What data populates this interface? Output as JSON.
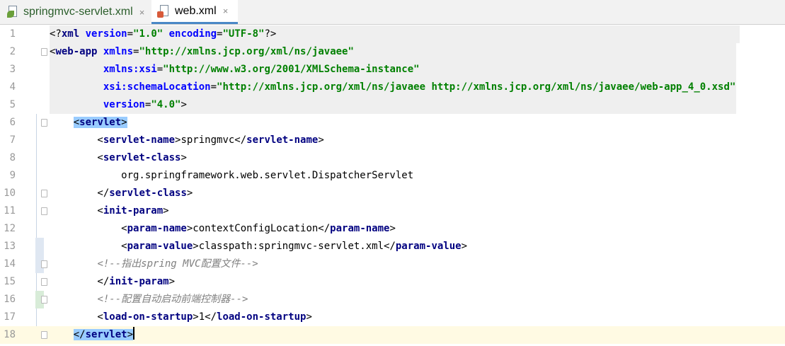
{
  "tabs": [
    {
      "label": "springmvc-servlet.xml",
      "close": "×",
      "icon": "spring-xml-file-icon",
      "active": false
    },
    {
      "label": "web.xml",
      "close": "×",
      "icon": "xml-file-icon",
      "active": true
    }
  ],
  "editor": {
    "caret_line": 18,
    "lines": [
      {
        "n": "1",
        "parts": [
          [
            "txt",
            "<?"
          ],
          [
            "tag",
            "xml"
          ],
          [
            "attr",
            " version"
          ],
          [
            "txt",
            "="
          ],
          [
            "str",
            "\"1.0\""
          ],
          [
            "attr",
            " encoding"
          ],
          [
            "txt",
            "="
          ],
          [
            "str",
            "\"UTF-8\""
          ],
          [
            "txt",
            "?>"
          ]
        ]
      },
      {
        "n": "2",
        "parts": [
          [
            "txt",
            "<"
          ],
          [
            "tag",
            "web-app"
          ],
          [
            "attr",
            " xmlns"
          ],
          [
            "txt",
            "="
          ],
          [
            "str",
            "\"http://xmlns.jcp.org/xml/ns/javaee\""
          ]
        ]
      },
      {
        "n": "3",
        "parts": [
          [
            "txt",
            "         "
          ],
          [
            "attr",
            "xmlns:xsi"
          ],
          [
            "txt",
            "="
          ],
          [
            "str",
            "\"http://www.w3.org/2001/XMLSchema-instance\""
          ]
        ]
      },
      {
        "n": "4",
        "parts": [
          [
            "txt",
            "         "
          ],
          [
            "attr",
            "xsi:schemaLocation"
          ],
          [
            "txt",
            "="
          ],
          [
            "str",
            "\"http://xmlns.jcp.org/xml/ns/javaee http://xmlns.jcp.org/xml/ns/javaee/web-app_4_0.xsd\""
          ]
        ]
      },
      {
        "n": "5",
        "parts": [
          [
            "txt",
            "         "
          ],
          [
            "attr",
            "version"
          ],
          [
            "txt",
            "="
          ],
          [
            "str",
            "\"4.0\""
          ],
          [
            "txt",
            ">"
          ]
        ]
      },
      {
        "n": "6",
        "parts": [
          [
            "txt",
            "    "
          ],
          [
            "match",
            "<servlet>"
          ]
        ]
      },
      {
        "n": "7",
        "parts": [
          [
            "txt",
            "        <"
          ],
          [
            "tag",
            "servlet-name"
          ],
          [
            "txt",
            ">springmvc</"
          ],
          [
            "tag",
            "servlet-name"
          ],
          [
            "txt",
            ">"
          ]
        ]
      },
      {
        "n": "8",
        "parts": [
          [
            "txt",
            "        <"
          ],
          [
            "tag",
            "servlet-class"
          ],
          [
            "txt",
            ">"
          ]
        ]
      },
      {
        "n": "9",
        "parts": [
          [
            "txt",
            "            org.springframework.web.servlet.DispatcherServlet"
          ]
        ]
      },
      {
        "n": "10",
        "parts": [
          [
            "txt",
            "        </"
          ],
          [
            "tag",
            "servlet-class"
          ],
          [
            "txt",
            ">"
          ]
        ]
      },
      {
        "n": "11",
        "parts": [
          [
            "txt",
            "        <"
          ],
          [
            "tag",
            "init-param"
          ],
          [
            "txt",
            ">"
          ]
        ]
      },
      {
        "n": "12",
        "parts": [
          [
            "txt",
            "            <"
          ],
          [
            "tag",
            "param-name"
          ],
          [
            "txt",
            ">contextConfigLocation</"
          ],
          [
            "tag",
            "param-name"
          ],
          [
            "txt",
            ">"
          ]
        ]
      },
      {
        "n": "13",
        "parts": [
          [
            "txt",
            "            <"
          ],
          [
            "tag",
            "param-value"
          ],
          [
            "txt",
            ">classpath:springmvc-servlet.xml</"
          ],
          [
            "tag",
            "param-value"
          ],
          [
            "txt",
            ">"
          ]
        ]
      },
      {
        "n": "14",
        "parts": [
          [
            "txt",
            "        "
          ],
          [
            "cmt",
            "<!--指出spring MVC配置文件-->"
          ]
        ]
      },
      {
        "n": "15",
        "parts": [
          [
            "txt",
            "        </"
          ],
          [
            "tag",
            "init-param"
          ],
          [
            "txt",
            ">"
          ]
        ]
      },
      {
        "n": "16",
        "parts": [
          [
            "txt",
            "        "
          ],
          [
            "cmt",
            "<!--配置自动启动前端控制器-->"
          ]
        ]
      },
      {
        "n": "17",
        "parts": [
          [
            "txt",
            "        <"
          ],
          [
            "tag",
            "load-on-startup"
          ],
          [
            "txt",
            ">1</"
          ],
          [
            "tag",
            "load-on-startup"
          ],
          [
            "txt",
            ">"
          ]
        ]
      },
      {
        "n": "18",
        "parts": [
          [
            "txt",
            "    "
          ],
          [
            "match",
            "</servlet>"
          ]
        ]
      }
    ]
  },
  "colors": {
    "tag": "#000080",
    "attribute": "#0000ff",
    "string": "#008000",
    "comment": "#808080",
    "tag_match_highlight": "#99ccff",
    "caret_line": "#fffae3",
    "active_tab_underline": "#4a88c7"
  }
}
